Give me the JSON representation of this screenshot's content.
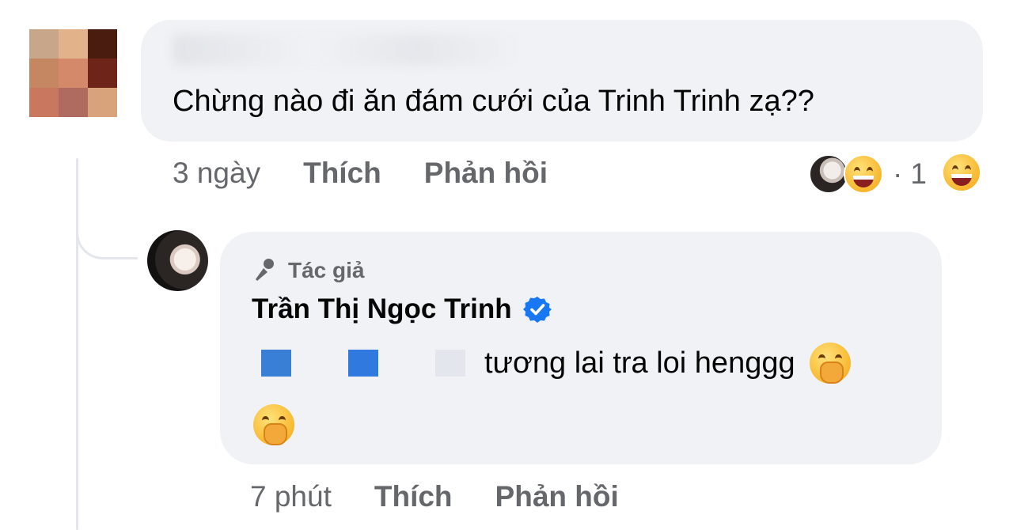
{
  "comment": {
    "text": "Chừng nào đi ăn đám cưới của Trinh Trinh zạ??",
    "time": "3 ngày",
    "like_label": "Thích",
    "reply_label": "Phản hồi",
    "reaction_count": "1"
  },
  "reply": {
    "author_badge": "Tác giả",
    "author_name": "Trần Thị Ngọc Trinh",
    "text": "tương lai tra loi henggg",
    "time": "7 phút",
    "like_label": "Thích",
    "reply_label": "Phản hồi"
  },
  "colors": {
    "bubble": "#f0f2f5",
    "meta_text": "#65676b",
    "verified": "#1877f2"
  }
}
